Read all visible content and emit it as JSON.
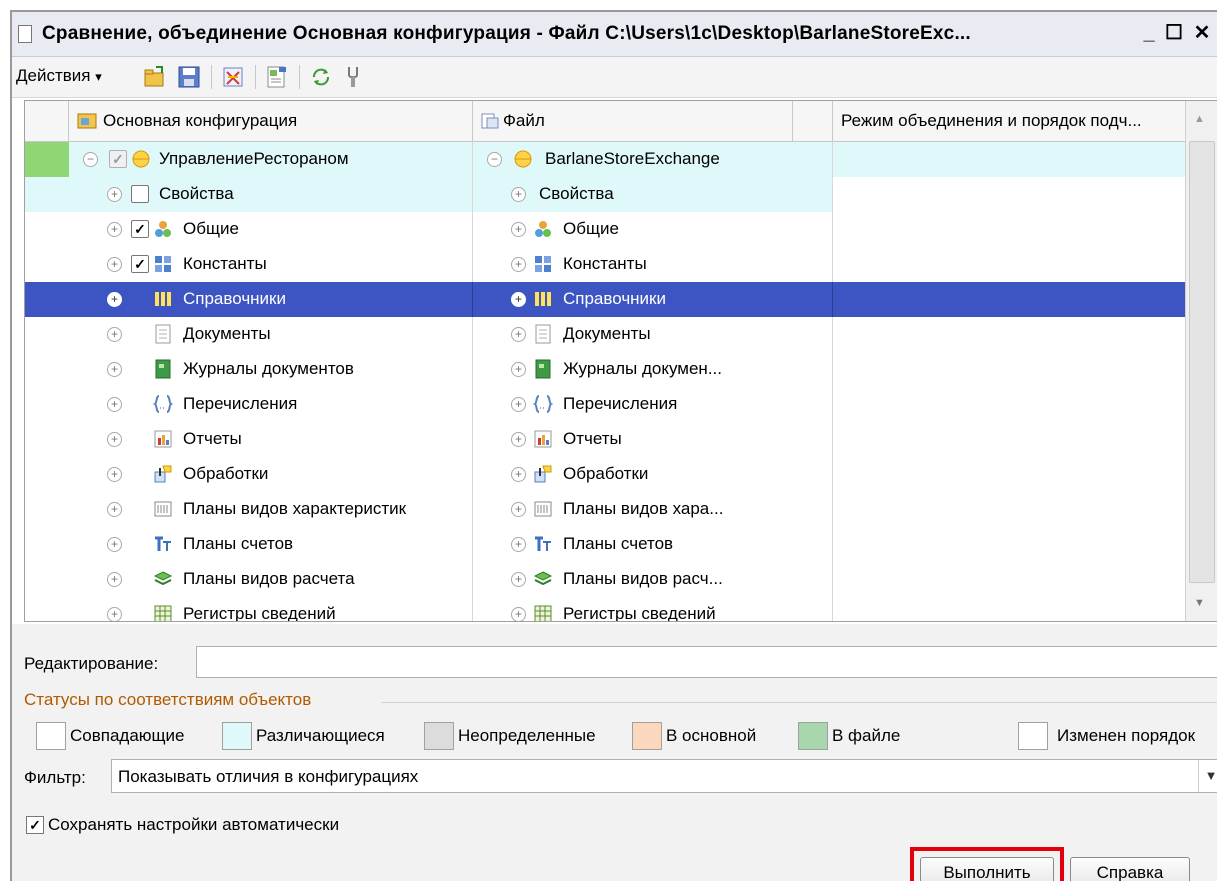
{
  "window": {
    "title": "Сравнение, объединение Основная конфигурация - Файл C:\\Users\\1c\\Desktop\\BarlaneStoreExc...",
    "minimize": "_",
    "maximize": "☐",
    "close": "✕"
  },
  "toolbar": {
    "actions_label": "Действия",
    "actions_arrow": "▾"
  },
  "columns": {
    "main": "Основная конфигурация",
    "file": "Файл",
    "mode": "Режим объединения и порядок подч..."
  },
  "tree": {
    "root": {
      "main": "УправлениеРестораном",
      "file": "BarlaneStoreExchange"
    },
    "rows": [
      {
        "main": "Свойства",
        "file": "Свойства",
        "checkbox": "unchecked",
        "icon": "none"
      },
      {
        "main": "Общие",
        "file": "Общие",
        "checkbox": "checked",
        "icon": "common-icon"
      },
      {
        "main": "Константы",
        "file": "Константы",
        "checkbox": "checked",
        "icon": "constants-icon"
      },
      {
        "main": "Справочники",
        "file": "Справочники",
        "checkbox": "none",
        "icon": "catalogs-icon",
        "selected": true
      },
      {
        "main": "Документы",
        "file": "Документы",
        "checkbox": "none",
        "icon": "document-icon"
      },
      {
        "main": "Журналы документов",
        "file": "Журналы докумен...",
        "checkbox": "none",
        "icon": "journal-icon"
      },
      {
        "main": "Перечисления",
        "file": "Перечисления",
        "checkbox": "none",
        "icon": "enum-icon"
      },
      {
        "main": "Отчеты",
        "file": "Отчеты",
        "checkbox": "none",
        "icon": "report-icon"
      },
      {
        "main": "Обработки",
        "file": "Обработки",
        "checkbox": "none",
        "icon": "processing-icon"
      },
      {
        "main": "Планы видов характеристик",
        "file": "Планы видов хара...",
        "checkbox": "none",
        "icon": "char-plan-icon"
      },
      {
        "main": "Планы счетов",
        "file": "Планы счетов",
        "checkbox": "none",
        "icon": "accounts-icon"
      },
      {
        "main": "Планы видов расчета",
        "file": "Планы видов расч...",
        "checkbox": "none",
        "icon": "calc-plan-icon"
      },
      {
        "main": "Регистры сведений",
        "file": "Регистры сведений",
        "checkbox": "none",
        "icon": "register-icon"
      }
    ]
  },
  "editing": {
    "label": "Редактирование:",
    "value": ""
  },
  "statuses": {
    "title": "Статусы по соответствиям объектов",
    "items": [
      {
        "label": "Совпадающие",
        "color": "#ffffff"
      },
      {
        "label": "Различающиеся",
        "color": "#dff8fa"
      },
      {
        "label": "Неопределенные",
        "color": "#dcdcdc"
      },
      {
        "label": "В основной",
        "color": "#fbd8bd"
      },
      {
        "label": "В файле",
        "color": "#a9d7ad"
      },
      {
        "label": "Изменен порядок",
        "color": "#ffffff"
      }
    ]
  },
  "filter": {
    "label": "Фильтр:",
    "value": "Показывать отличия в конфигурациях"
  },
  "autosave": {
    "label": "Сохранять настройки автоматически",
    "checked": true
  },
  "buttons": {
    "run": "Выполнить",
    "help": "Справка"
  },
  "colors": {
    "selection": "#3d55c2",
    "differs": "#dff8fa",
    "marker": "#8fd774",
    "status_title": "#b05a00",
    "highlight": "#e3000b"
  }
}
